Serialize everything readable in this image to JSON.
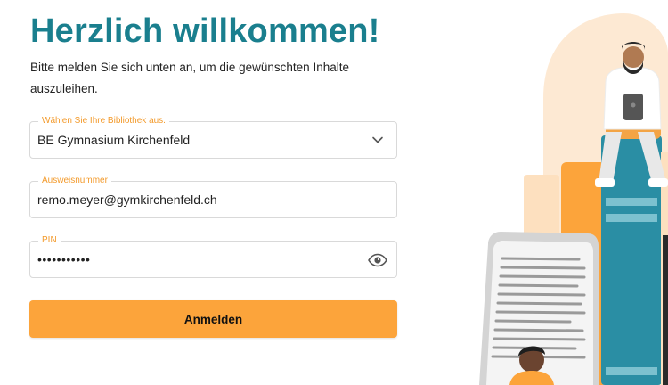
{
  "header": {
    "title": "Herzlich willkommen!",
    "intro": "Bitte melden Sie sich unten an, um die gewünschten Inhalte auszuleihen."
  },
  "form": {
    "library": {
      "label": "Wählen Sie Ihre Bibliothek aus.",
      "value": "BE Gymnasium Kirchenfeld"
    },
    "card": {
      "label": "Ausweisnummer",
      "value": "remo.meyer@gymkirchenfeld.ch"
    },
    "pin": {
      "label": "PIN",
      "value": "•••••••••••"
    },
    "submit_label": "Anmelden"
  },
  "icons": {
    "dropdown": "chevron-down-icon",
    "show_password": "eye-icon"
  },
  "colors": {
    "title": "#1a7f8e",
    "accent": "#fca43b",
    "label": "#f39a2b"
  }
}
